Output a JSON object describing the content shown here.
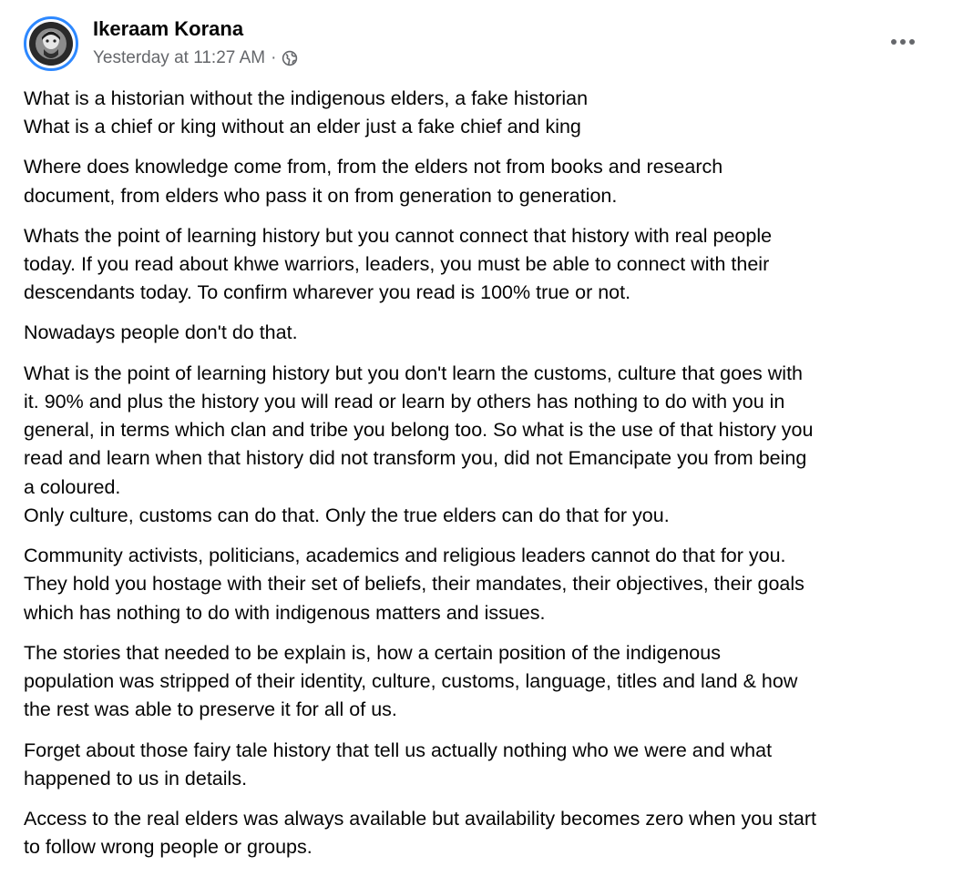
{
  "post": {
    "author": "Ikeraam Korana",
    "timestamp": "Yesterday at 11:27 AM",
    "separator": "·",
    "privacy_icon": "globe-icon",
    "more_icon": "more-horizontal-icon",
    "colors": {
      "name": "#050505",
      "meta": "#65676b",
      "avatar_ring": "#2d88ff"
    },
    "paragraphs": [
      [
        "What is a historian without the indigenous elders, a fake historian",
        "What is a chief or king without an elder just a fake chief and king"
      ],
      [
        "Where does knowledge come from, from the elders not from books and research",
        "document, from elders who pass it on from generation to generation."
      ],
      [
        "Whats the point of learning history but you cannot connect that history with real people",
        "today. If you read about khwe warriors, leaders, you must be able to connect with their",
        "descendants today. To confirm wharever you read is 100% true or not."
      ],
      [
        "Nowadays people don't do that."
      ],
      [
        "What is the point of learning history but you don't learn the customs, culture that goes with",
        "it. 90% and plus the history you will read or learn by others has nothing to do with you in",
        "general, in terms which clan and tribe you belong too. So what is the use of that history you",
        "read and learn when that history did not transform you, did not Emancipate you from being",
        "a coloured.",
        "Only culture, customs can do that. Only the true elders can do that for you."
      ],
      [
        "Community activists, politicians, academics and religious leaders cannot do that for you.",
        "They hold you hostage with their set of beliefs, their mandates, their objectives, their goals",
        "which has nothing to do with indigenous matters and issues."
      ],
      [
        "The stories that needed to be explain is, how a certain position of the indigenous",
        "population was stripped of their identity, culture, customs, language, titles and land & how",
        "the rest was able to preserve it for all of us."
      ],
      [
        "Forget about those fairy tale history that tell us actually nothing who we were and what",
        "happened to us in details."
      ],
      [
        "Access to the real elders was always available but availability becomes zero when you start",
        "to follow wrong people or groups."
      ]
    ]
  }
}
